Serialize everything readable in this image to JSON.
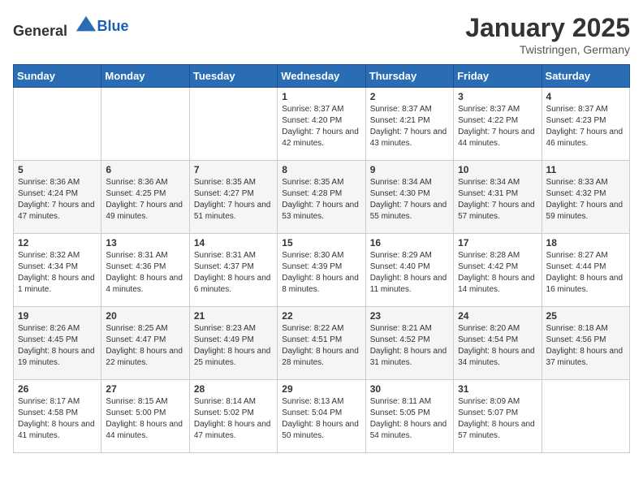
{
  "header": {
    "logo_general": "General",
    "logo_blue": "Blue",
    "month": "January 2025",
    "location": "Twistringen, Germany"
  },
  "weekdays": [
    "Sunday",
    "Monday",
    "Tuesday",
    "Wednesday",
    "Thursday",
    "Friday",
    "Saturday"
  ],
  "weeks": [
    [
      {
        "day": "",
        "info": ""
      },
      {
        "day": "",
        "info": ""
      },
      {
        "day": "",
        "info": ""
      },
      {
        "day": "1",
        "info": "Sunrise: 8:37 AM\nSunset: 4:20 PM\nDaylight: 7 hours and 42 minutes."
      },
      {
        "day": "2",
        "info": "Sunrise: 8:37 AM\nSunset: 4:21 PM\nDaylight: 7 hours and 43 minutes."
      },
      {
        "day": "3",
        "info": "Sunrise: 8:37 AM\nSunset: 4:22 PM\nDaylight: 7 hours and 44 minutes."
      },
      {
        "day": "4",
        "info": "Sunrise: 8:37 AM\nSunset: 4:23 PM\nDaylight: 7 hours and 46 minutes."
      }
    ],
    [
      {
        "day": "5",
        "info": "Sunrise: 8:36 AM\nSunset: 4:24 PM\nDaylight: 7 hours and 47 minutes."
      },
      {
        "day": "6",
        "info": "Sunrise: 8:36 AM\nSunset: 4:25 PM\nDaylight: 7 hours and 49 minutes."
      },
      {
        "day": "7",
        "info": "Sunrise: 8:35 AM\nSunset: 4:27 PM\nDaylight: 7 hours and 51 minutes."
      },
      {
        "day": "8",
        "info": "Sunrise: 8:35 AM\nSunset: 4:28 PM\nDaylight: 7 hours and 53 minutes."
      },
      {
        "day": "9",
        "info": "Sunrise: 8:34 AM\nSunset: 4:30 PM\nDaylight: 7 hours and 55 minutes."
      },
      {
        "day": "10",
        "info": "Sunrise: 8:34 AM\nSunset: 4:31 PM\nDaylight: 7 hours and 57 minutes."
      },
      {
        "day": "11",
        "info": "Sunrise: 8:33 AM\nSunset: 4:32 PM\nDaylight: 7 hours and 59 minutes."
      }
    ],
    [
      {
        "day": "12",
        "info": "Sunrise: 8:32 AM\nSunset: 4:34 PM\nDaylight: 8 hours and 1 minute."
      },
      {
        "day": "13",
        "info": "Sunrise: 8:31 AM\nSunset: 4:36 PM\nDaylight: 8 hours and 4 minutes."
      },
      {
        "day": "14",
        "info": "Sunrise: 8:31 AM\nSunset: 4:37 PM\nDaylight: 8 hours and 6 minutes."
      },
      {
        "day": "15",
        "info": "Sunrise: 8:30 AM\nSunset: 4:39 PM\nDaylight: 8 hours and 8 minutes."
      },
      {
        "day": "16",
        "info": "Sunrise: 8:29 AM\nSunset: 4:40 PM\nDaylight: 8 hours and 11 minutes."
      },
      {
        "day": "17",
        "info": "Sunrise: 8:28 AM\nSunset: 4:42 PM\nDaylight: 8 hours and 14 minutes."
      },
      {
        "day": "18",
        "info": "Sunrise: 8:27 AM\nSunset: 4:44 PM\nDaylight: 8 hours and 16 minutes."
      }
    ],
    [
      {
        "day": "19",
        "info": "Sunrise: 8:26 AM\nSunset: 4:45 PM\nDaylight: 8 hours and 19 minutes."
      },
      {
        "day": "20",
        "info": "Sunrise: 8:25 AM\nSunset: 4:47 PM\nDaylight: 8 hours and 22 minutes."
      },
      {
        "day": "21",
        "info": "Sunrise: 8:23 AM\nSunset: 4:49 PM\nDaylight: 8 hours and 25 minutes."
      },
      {
        "day": "22",
        "info": "Sunrise: 8:22 AM\nSunset: 4:51 PM\nDaylight: 8 hours and 28 minutes."
      },
      {
        "day": "23",
        "info": "Sunrise: 8:21 AM\nSunset: 4:52 PM\nDaylight: 8 hours and 31 minutes."
      },
      {
        "day": "24",
        "info": "Sunrise: 8:20 AM\nSunset: 4:54 PM\nDaylight: 8 hours and 34 minutes."
      },
      {
        "day": "25",
        "info": "Sunrise: 8:18 AM\nSunset: 4:56 PM\nDaylight: 8 hours and 37 minutes."
      }
    ],
    [
      {
        "day": "26",
        "info": "Sunrise: 8:17 AM\nSunset: 4:58 PM\nDaylight: 8 hours and 41 minutes."
      },
      {
        "day": "27",
        "info": "Sunrise: 8:15 AM\nSunset: 5:00 PM\nDaylight: 8 hours and 44 minutes."
      },
      {
        "day": "28",
        "info": "Sunrise: 8:14 AM\nSunset: 5:02 PM\nDaylight: 8 hours and 47 minutes."
      },
      {
        "day": "29",
        "info": "Sunrise: 8:13 AM\nSunset: 5:04 PM\nDaylight: 8 hours and 50 minutes."
      },
      {
        "day": "30",
        "info": "Sunrise: 8:11 AM\nSunset: 5:05 PM\nDaylight: 8 hours and 54 minutes."
      },
      {
        "day": "31",
        "info": "Sunrise: 8:09 AM\nSunset: 5:07 PM\nDaylight: 8 hours and 57 minutes."
      },
      {
        "day": "",
        "info": ""
      }
    ]
  ]
}
